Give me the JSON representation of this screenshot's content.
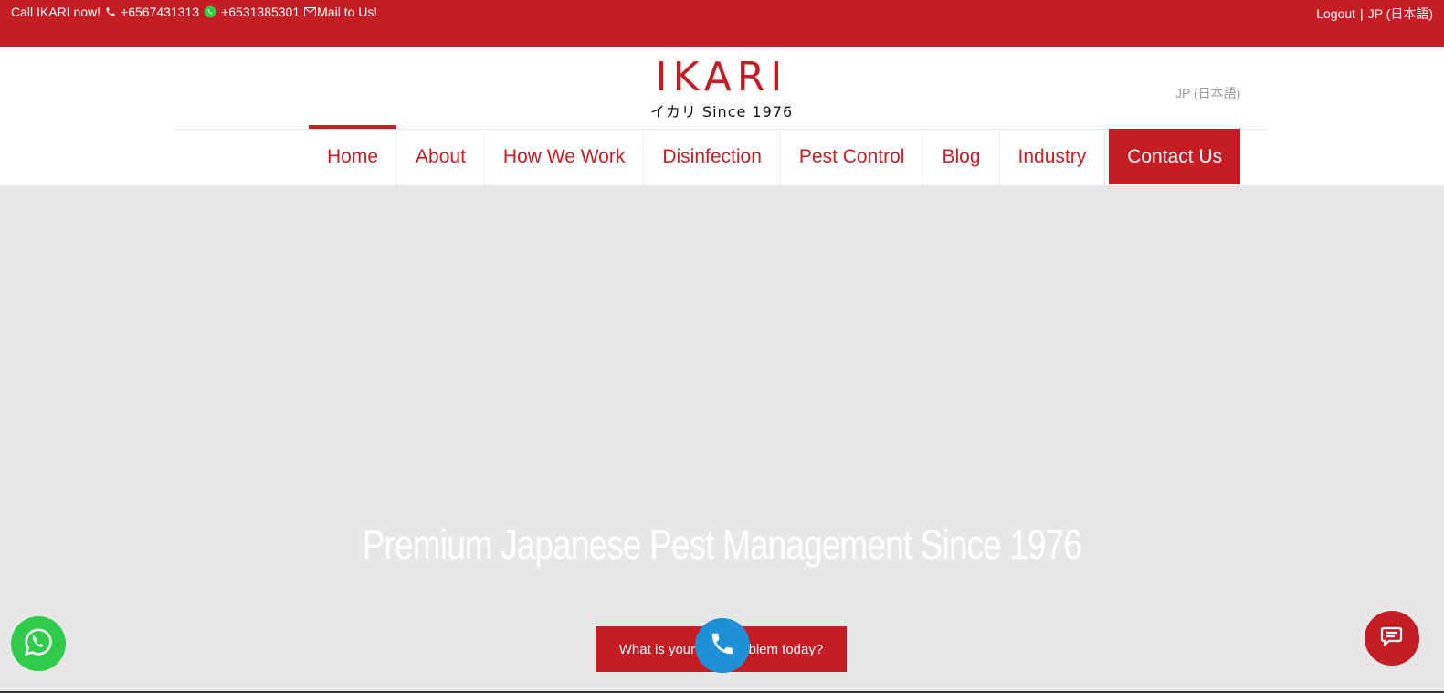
{
  "topbar": {
    "call_text": "Call IKARI now!",
    "phone_icon": "phone-icon",
    "phone": "+6567431313",
    "whatsapp_icon": "whatsapp-icon",
    "whatsapp": "+6531385301",
    "mail_icon": "mail-icon",
    "mail_label": "Mail to Us!",
    "logout": "Logout",
    "separator": "|",
    "language": "JP (日本語)"
  },
  "header": {
    "logo_brand": "IKARI",
    "logo_sub": "イカリ Since 1976",
    "language_link": "JP (日本語)"
  },
  "nav": {
    "items": [
      {
        "label": "Home",
        "active": true
      },
      {
        "label": "About"
      },
      {
        "label": "How We Work"
      },
      {
        "label": "Disinfection"
      },
      {
        "label": "Pest Control"
      },
      {
        "label": "Blog"
      },
      {
        "label": "Industry"
      },
      {
        "label": "Contact Us"
      }
    ]
  },
  "hero": {
    "title": "Premium Japanese Pest Management Since 1976",
    "cta_label": "What is your pest problem today?"
  },
  "floating": {
    "whatsapp_icon": "whatsapp-icon",
    "call_icon": "phone-icon",
    "chat_icon": "chat-icon"
  },
  "colors": {
    "brand_red": "#c41e24",
    "hero_bg": "#e7e7e7",
    "whatsapp_green": "#2fcc4b",
    "call_blue": "#1e90d8"
  }
}
